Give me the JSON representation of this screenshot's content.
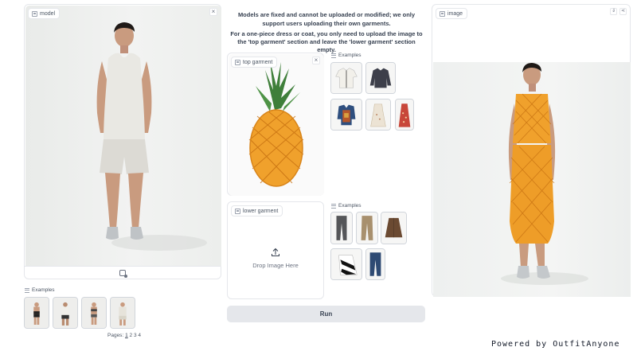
{
  "model_panel": {
    "label": "model",
    "close_glyph": "×"
  },
  "model_examples": {
    "header": "Examples",
    "pages_label": "Pages:",
    "pages": [
      "1",
      "2",
      "3",
      "4"
    ],
    "current_page": "1"
  },
  "info": {
    "line1": "Models are fixed and cannot be uploaded or modified; we only support users uploading their own garments.",
    "line2": "For a one-piece dress or coat, you only need to upload the image to the 'top garment' section and leave the 'lower garment' section empty."
  },
  "top_garment": {
    "label": "top garment",
    "close_glyph": "×"
  },
  "top_examples": {
    "header": "Examples"
  },
  "lower_garment": {
    "label": "lower garment",
    "drop_text": "Drop Image Here"
  },
  "lower_examples": {
    "header": "Examples"
  },
  "run_button": {
    "label": "Run"
  },
  "output_panel": {
    "label": "image",
    "download_glyph": "⇓",
    "share_glyph": "⋖"
  },
  "footer": {
    "powered": "Powered by OutfitAnyone"
  },
  "icons": [
    "image-icon",
    "close-icon",
    "upload-icon",
    "list-icon",
    "download-icon",
    "share-icon",
    "webcam-icon"
  ]
}
